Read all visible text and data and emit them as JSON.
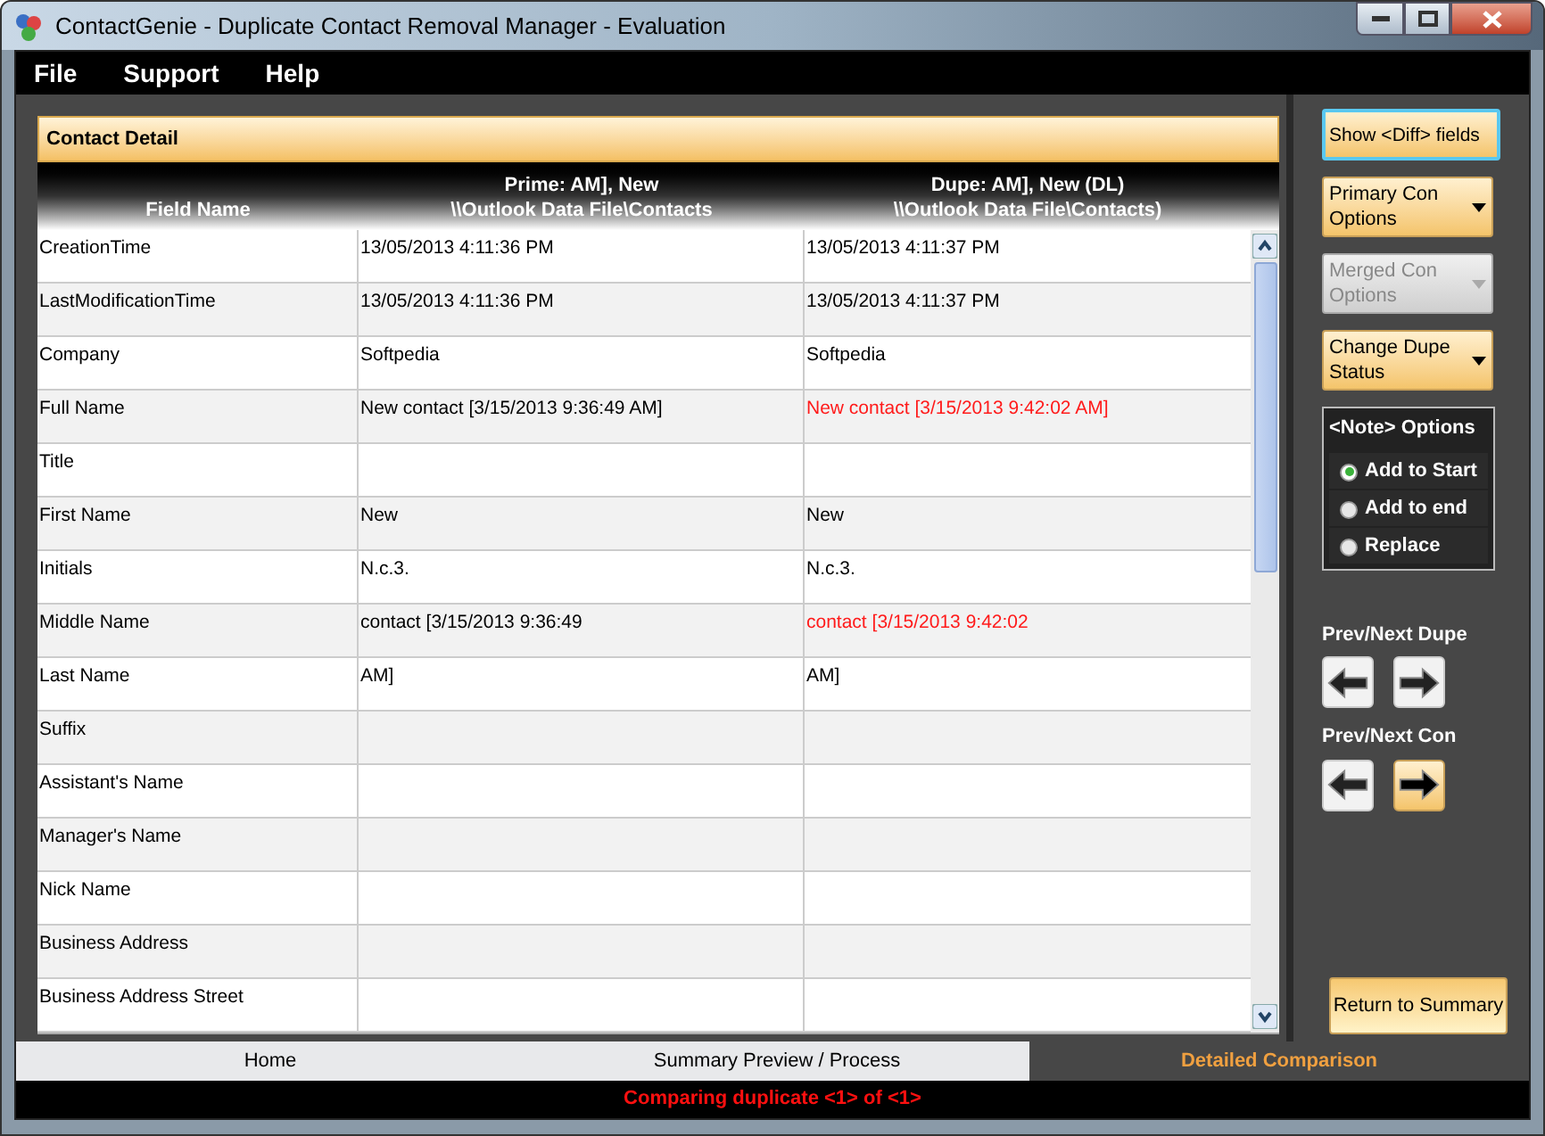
{
  "window": {
    "title": "ContactGenie - Duplicate Contact Removal Manager - Evaluation"
  },
  "menu": [
    "File",
    "Support",
    "Help"
  ],
  "panel": {
    "title": "Contact Detail"
  },
  "columns": [
    {
      "line2": "Field Name"
    },
    {
      "line1": "Prime: AM], New",
      "line2": "\\\\Outlook Data File\\Contacts"
    },
    {
      "line1": "Dupe: AM], New (DL)",
      "line2": "\\\\Outlook Data File\\Contacts)"
    }
  ],
  "rows": [
    {
      "field": "CreationTime",
      "prime": "13/05/2013 4:11:36 PM",
      "dupe": "13/05/2013 4:11:37 PM",
      "diff": false
    },
    {
      "field": "LastModificationTime",
      "prime": "13/05/2013 4:11:36 PM",
      "dupe": "13/05/2013 4:11:37 PM",
      "diff": false
    },
    {
      "field": "Company",
      "prime": "Softpedia",
      "dupe": "Softpedia",
      "diff": false
    },
    {
      "field": "Full Name",
      "prime": "New contact [3/15/2013 9:36:49 AM]",
      "dupe": "New contact [3/15/2013 9:42:02 AM]",
      "diff": true
    },
    {
      "field": "Title"
    },
    {
      "field": "First Name",
      "prime": "New",
      "dupe": "New",
      "diff": false
    },
    {
      "field": "Initials",
      "prime": "N.c.3.",
      "dupe": "N.c.3.",
      "diff": false
    },
    {
      "field": "Middle Name",
      "prime": "contact [3/15/2013 9:36:49",
      "dupe": "contact [3/15/2013 9:42:02",
      "diff": true
    },
    {
      "field": "Last Name",
      "prime": "AM]",
      "dupe": "AM]",
      "diff": false
    },
    {
      "field": "Suffix"
    },
    {
      "field": "Assistant's Name"
    },
    {
      "field": "Manager's Name"
    },
    {
      "field": "Nick Name"
    },
    {
      "field": "Business Address"
    },
    {
      "field": "Business Address Street"
    }
  ],
  "actions": [
    {
      "label": "Show <Diff> fields",
      "dropdown": false,
      "disabled": false,
      "focused": true
    },
    {
      "label": "Primary Con Options",
      "dropdown": true,
      "disabled": false,
      "focused": false
    },
    {
      "label": "Merged Con Options",
      "dropdown": true,
      "disabled": true,
      "focused": false
    },
    {
      "label": "Change Dupe Status",
      "dropdown": true,
      "disabled": false,
      "focused": false
    }
  ],
  "note_options": {
    "title": "<Note> Options",
    "options": [
      {
        "label": "Add to Start",
        "selected": true
      },
      {
        "label": "Add to end",
        "selected": false
      },
      {
        "label": "Replace",
        "selected": false
      }
    ]
  },
  "navigators": [
    {
      "label": "Prev/Next Dupe",
      "buttons": [
        {
          "kind": "prev",
          "highlighted": false
        },
        {
          "kind": "next",
          "highlighted": false
        }
      ]
    },
    {
      "label": "Prev/Next Con",
      "buttons": [
        {
          "kind": "prev",
          "highlighted": false
        },
        {
          "kind": "next",
          "highlighted": true
        }
      ]
    }
  ],
  "return_button": "Return to Summary",
  "tabs": [
    {
      "label": "Home",
      "selected": false
    },
    {
      "label": "Summary Preview / Process",
      "selected": false
    },
    {
      "label": "Detailed Comparison",
      "selected": true
    }
  ],
  "status": "Comparing duplicate <1> of <1>"
}
